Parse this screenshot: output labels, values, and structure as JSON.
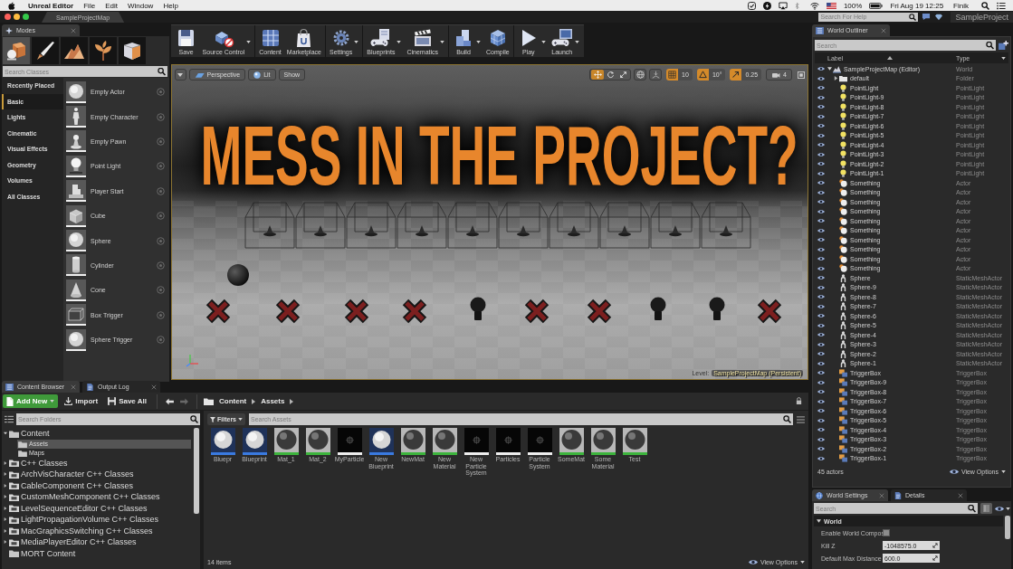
{
  "menubar": {
    "app": "Unreal Editor",
    "menus": [
      "File",
      "Edit",
      "Window",
      "Help"
    ],
    "battery": "100%",
    "clock": "Fri Aug 19 12:25",
    "user": "Finik"
  },
  "titlebar": {
    "tab": "SampleProjectMap",
    "help_search": {
      "placeholder": "Search For Help"
    },
    "project": "SampleProject"
  },
  "modes": {
    "tab": "Modes",
    "mode_tabs": [
      {
        "kind": "place",
        "selected": true
      },
      {
        "kind": "paint",
        "selected": false
      },
      {
        "kind": "landscape",
        "selected": false
      },
      {
        "kind": "foliage",
        "selected": false
      },
      {
        "kind": "geometry",
        "selected": false
      }
    ],
    "search": {
      "placeholder": "Search Classes"
    },
    "categories": [
      {
        "label": "Recently Placed",
        "selected": false
      },
      {
        "label": "Basic",
        "selected": true
      },
      {
        "label": "Lights",
        "selected": false
      },
      {
        "label": "Cinematic",
        "selected": false
      },
      {
        "label": "Visual Effects",
        "selected": false
      },
      {
        "label": "Geometry",
        "selected": false
      },
      {
        "label": "Volumes",
        "selected": false
      },
      {
        "label": "All Classes",
        "selected": false
      }
    ],
    "items": [
      {
        "label": "Empty Actor",
        "kind": "sphere"
      },
      {
        "label": "Empty Character",
        "kind": "character"
      },
      {
        "label": "Empty Pawn",
        "kind": "pawn"
      },
      {
        "label": "Point Light",
        "kind": "light"
      },
      {
        "label": "Player Start",
        "kind": "start"
      },
      {
        "label": "Cube",
        "kind": "cube"
      },
      {
        "label": "Sphere",
        "kind": "sphere"
      },
      {
        "label": "Cylinder",
        "kind": "cylinder"
      },
      {
        "label": "Cone",
        "kind": "cone"
      },
      {
        "label": "Box Trigger",
        "kind": "box"
      },
      {
        "label": "Sphere Trigger",
        "kind": "sphere"
      }
    ]
  },
  "toolbar": {
    "groups": [
      {
        "buttons": [
          {
            "label": "Save",
            "kind": "save",
            "dropdown": false
          },
          {
            "label": "Source Control",
            "kind": "source",
            "dropdown": true
          }
        ]
      },
      {
        "buttons": [
          {
            "label": "Content",
            "kind": "content",
            "dropdown": false
          },
          {
            "label": "Marketplace",
            "kind": "market",
            "dropdown": false
          }
        ]
      },
      {
        "buttons": [
          {
            "label": "Settings",
            "kind": "settings",
            "dropdown": true
          }
        ]
      },
      {
        "buttons": [
          {
            "label": "Blueprints",
            "kind": "blueprints",
            "dropdown": true
          },
          {
            "label": "Cinematics",
            "kind": "cinematics",
            "dropdown": true
          }
        ]
      },
      {
        "buttons": [
          {
            "label": "Build",
            "kind": "build",
            "dropdown": true
          },
          {
            "label": "Compile",
            "kind": "compile",
            "dropdown": false
          }
        ]
      },
      {
        "buttons": [
          {
            "label": "Play",
            "kind": "play",
            "dropdown": true
          },
          {
            "label": "Launch",
            "kind": "launch",
            "dropdown": true
          }
        ]
      }
    ]
  },
  "viewport": {
    "view": "Perspective",
    "lighting": "Lit",
    "show": "Show",
    "transform_tools": [
      {
        "kind": "move",
        "selected": true
      },
      {
        "kind": "rotate",
        "selected": false
      },
      {
        "kind": "scale",
        "selected": false
      }
    ],
    "snaps": [
      {
        "kind": "grid",
        "on": true,
        "value": "10"
      },
      {
        "kind": "rotation",
        "on": true,
        "value": "10°"
      },
      {
        "kind": "scale",
        "on": true,
        "value": "0.25"
      }
    ],
    "camera_speed": "4",
    "headline": "MESS IN THE PROJECT?",
    "level_label": "Level:",
    "level_name": "SampleProjectMap (Persistent)"
  },
  "outliner": {
    "tab": "World Outliner",
    "search": {
      "placeholder": "Search"
    },
    "columns": [
      "Label",
      "Type"
    ],
    "rows": [
      {
        "label": "SampleProjectMap (Editor)",
        "type": "World",
        "kind": "world",
        "expanded": true,
        "children": [
          {
            "label": "default",
            "type": "Folder",
            "kind": "folder",
            "expanded": false
          },
          {
            "label": "PointLight",
            "type": "PointLight",
            "kind": "light"
          },
          {
            "label": "PointLight-9",
            "type": "PointLight",
            "kind": "light"
          },
          {
            "label": "PointLight-8",
            "type": "PointLight",
            "kind": "light"
          },
          {
            "label": "PointLight-7",
            "type": "PointLight",
            "kind": "light"
          },
          {
            "label": "PointLight-6",
            "type": "PointLight",
            "kind": "light"
          },
          {
            "label": "PointLight-5",
            "type": "PointLight",
            "kind": "light"
          },
          {
            "label": "PointLight-4",
            "type": "PointLight",
            "kind": "light"
          },
          {
            "label": "PointLight-3",
            "type": "PointLight",
            "kind": "light"
          },
          {
            "label": "PointLight-2",
            "type": "PointLight",
            "kind": "light"
          },
          {
            "label": "PointLight-1",
            "type": "PointLight",
            "kind": "light"
          },
          {
            "label": "Something",
            "type": "Actor",
            "kind": "actor"
          },
          {
            "label": "Something",
            "type": "Actor",
            "kind": "actor"
          },
          {
            "label": "Something",
            "type": "Actor",
            "kind": "actor"
          },
          {
            "label": "Something",
            "type": "Actor",
            "kind": "actor"
          },
          {
            "label": "Something",
            "type": "Actor",
            "kind": "actor"
          },
          {
            "label": "Something",
            "type": "Actor",
            "kind": "actor"
          },
          {
            "label": "Something",
            "type": "Actor",
            "kind": "actor"
          },
          {
            "label": "Something",
            "type": "Actor",
            "kind": "actor"
          },
          {
            "label": "Something",
            "type": "Actor",
            "kind": "actor"
          },
          {
            "label": "Something",
            "type": "Actor",
            "kind": "actor"
          },
          {
            "label": "Sphere",
            "type": "StaticMeshActor",
            "kind": "mesh"
          },
          {
            "label": "Sphere-9",
            "type": "StaticMeshActor",
            "kind": "mesh"
          },
          {
            "label": "Sphere-8",
            "type": "StaticMeshActor",
            "kind": "mesh"
          },
          {
            "label": "Sphere-7",
            "type": "StaticMeshActor",
            "kind": "mesh"
          },
          {
            "label": "Sphere-6",
            "type": "StaticMeshActor",
            "kind": "mesh"
          },
          {
            "label": "Sphere-5",
            "type": "StaticMeshActor",
            "kind": "mesh"
          },
          {
            "label": "Sphere-4",
            "type": "StaticMeshActor",
            "kind": "mesh"
          },
          {
            "label": "Sphere-3",
            "type": "StaticMeshActor",
            "kind": "mesh"
          },
          {
            "label": "Sphere-2",
            "type": "StaticMeshActor",
            "kind": "mesh"
          },
          {
            "label": "Sphere-1",
            "type": "StaticMeshActor",
            "kind": "mesh"
          },
          {
            "label": "TriggerBox",
            "type": "TriggerBox",
            "kind": "trigger"
          },
          {
            "label": "TriggerBox-9",
            "type": "TriggerBox",
            "kind": "trigger"
          },
          {
            "label": "TriggerBox-8",
            "type": "TriggerBox",
            "kind": "trigger"
          },
          {
            "label": "TriggerBox-7",
            "type": "TriggerBox",
            "kind": "trigger"
          },
          {
            "label": "TriggerBox-6",
            "type": "TriggerBox",
            "kind": "trigger"
          },
          {
            "label": "TriggerBox-5",
            "type": "TriggerBox",
            "kind": "trigger"
          },
          {
            "label": "TriggerBox-4",
            "type": "TriggerBox",
            "kind": "trigger"
          },
          {
            "label": "TriggerBox-3",
            "type": "TriggerBox",
            "kind": "trigger"
          },
          {
            "label": "TriggerBox-2",
            "type": "TriggerBox",
            "kind": "trigger"
          },
          {
            "label": "TriggerBox-1",
            "type": "TriggerBox",
            "kind": "trigger"
          }
        ]
      }
    ],
    "count": "45 actors",
    "view_options": "View Options"
  },
  "details": {
    "tabs": [
      {
        "label": "World Settings",
        "kind": "world",
        "selected": true
      },
      {
        "label": "Details",
        "kind": "details",
        "selected": false
      }
    ],
    "search": {
      "placeholder": "Search"
    },
    "section": {
      "label": "World",
      "expanded": true
    },
    "properties": [
      {
        "label": "Enable World Compos",
        "kind": "checkbox",
        "checked": false
      },
      {
        "label": "Kill Z",
        "kind": "number",
        "value": "-1048575.0"
      },
      {
        "label": "Default Max Distance",
        "kind": "number",
        "value": "600.0"
      }
    ]
  },
  "content_browser": {
    "tabs": [
      {
        "label": "Content Browser",
        "kind": "browser",
        "selected": true
      },
      {
        "label": "Output Log",
        "kind": "log",
        "selected": false
      }
    ],
    "add_new": "Add New",
    "import": "Import",
    "save_all": "Save All",
    "nav": [
      {
        "kind": "back",
        "disabled": false
      },
      {
        "kind": "forward",
        "disabled": true
      }
    ],
    "path": [
      "Content",
      "Assets"
    ],
    "folder_search": {
      "placeholder": "Search Folders"
    },
    "folders": [
      {
        "label": "Content",
        "kind": "folder",
        "expanded": true,
        "selected": false,
        "children": [
          {
            "label": "Assets",
            "kind": "folder",
            "selected": true
          },
          {
            "label": "Maps",
            "kind": "folder",
            "selected": false
          }
        ]
      },
      {
        "label": "C++ Classes",
        "kind": "code",
        "expanded": false,
        "selected": false
      },
      {
        "label": "ArchVisCharacter C++ Classes",
        "kind": "code",
        "expanded": false,
        "selected": false
      },
      {
        "label": "CableComponent C++ Classes",
        "kind": "code",
        "expanded": false,
        "selected": false
      },
      {
        "label": "CustomMeshComponent C++ Classes",
        "kind": "code",
        "expanded": false,
        "selected": false
      },
      {
        "label": "LevelSequenceEditor C++ Classes",
        "kind": "code",
        "expanded": false,
        "selected": false
      },
      {
        "label": "LightPropagationVolume C++ Classes",
        "kind": "code",
        "expanded": false,
        "selected": false
      },
      {
        "label": "MacGraphicsSwitching C++ Classes",
        "kind": "code",
        "expanded": false,
        "selected": false
      },
      {
        "label": "MediaPlayerEditor C++ Classes",
        "kind": "code",
        "expanded": false,
        "selected": false
      },
      {
        "label": "MORT Content",
        "kind": "folder",
        "selected": false
      }
    ],
    "filters": "Filters",
    "asset_search": {
      "placeholder": "Search Assets"
    },
    "assets": [
      {
        "label": "Bluepr",
        "kind": "blueprint"
      },
      {
        "label": "Blueprint",
        "kind": "blueprint"
      },
      {
        "label": "Mat_1",
        "kind": "material"
      },
      {
        "label": "Mat_2",
        "kind": "material"
      },
      {
        "label": "MyParticle",
        "kind": "particle"
      },
      {
        "label": "New Blueprint",
        "kind": "blueprint"
      },
      {
        "label": "NewMat",
        "kind": "material"
      },
      {
        "label": "New Material",
        "kind": "material"
      },
      {
        "label": "New Particle System",
        "kind": "particle"
      },
      {
        "label": "Particles",
        "kind": "particle"
      },
      {
        "label": "Particle System",
        "kind": "particle"
      },
      {
        "label": "SomeMat",
        "kind": "material"
      },
      {
        "label": "Some Material",
        "kind": "material"
      },
      {
        "label": "Test",
        "kind": "material"
      }
    ],
    "count": "14 items",
    "view_options": "View Options"
  }
}
